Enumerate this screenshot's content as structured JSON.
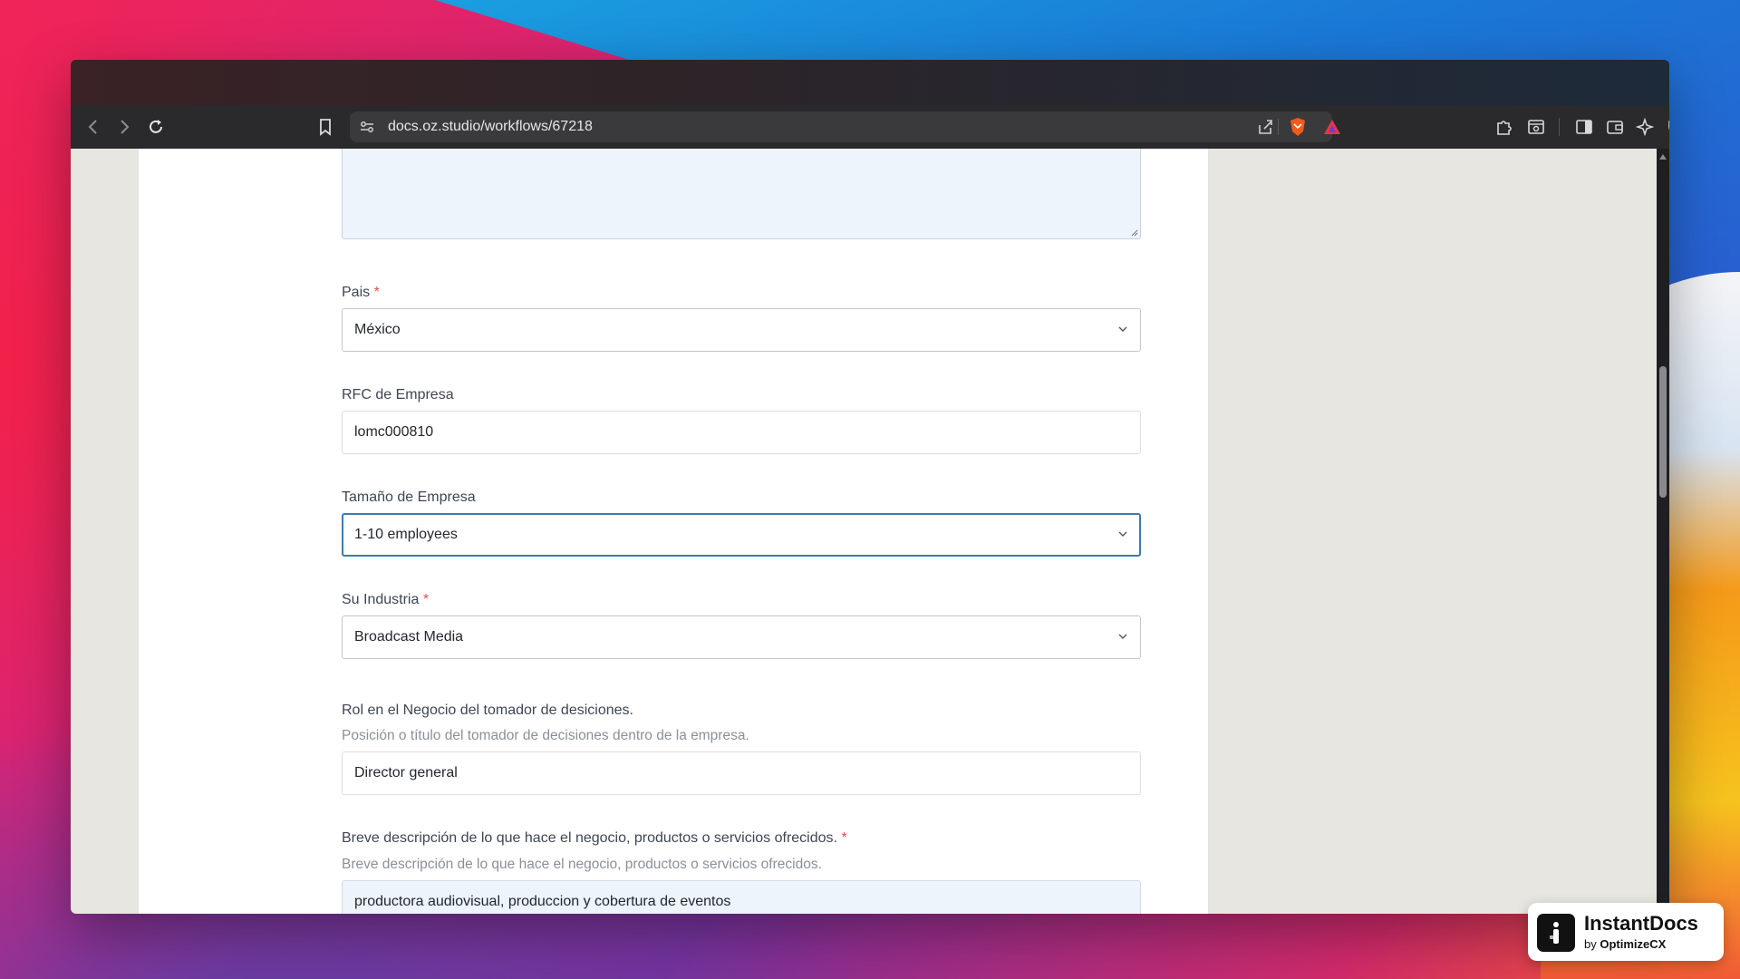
{
  "browser": {
    "url": "docs.oz.studio/workflows/67218"
  },
  "form": {
    "pais": {
      "label": "Pais",
      "required_mark": "*",
      "value": "México"
    },
    "rfc": {
      "label": "RFC de Empresa",
      "value": "lomc000810"
    },
    "tamano": {
      "label": "Tamaño de Empresa",
      "value": "1-10 employees"
    },
    "industria": {
      "label": "Su Industria",
      "required_mark": "*",
      "value": "Broadcast Media"
    },
    "rol": {
      "label": "Rol en el Negocio del tomador de desiciones.",
      "help": "Posición o título del tomador de decisiones dentro de la empresa.",
      "value": "Director general"
    },
    "descripcion": {
      "label": "Breve descripción de lo que hace el negocio, productos o servicios ofrecidos.",
      "required_mark": "*",
      "help": "Breve descripción de lo que hace el negocio, productos o servicios ofrecidos.",
      "value": "productora audiovisual, produccion y cobertura de eventos"
    }
  },
  "badge": {
    "title": "InstantDocs",
    "sub_prefix": "by",
    "sub_brand": "OptimizeCX"
  },
  "icons": {
    "back": "back-icon",
    "forward": "forward-icon",
    "reload": "reload-icon",
    "bookmark": "bookmark-icon",
    "site_settings": "site-settings-icon",
    "share": "share-icon",
    "brave_shield": "brave-shield-icon",
    "brave_rewards": "brave-rewards-icon",
    "extensions": "extensions-icon",
    "reader_mode": "reader-mode-icon",
    "sidebar": "sidebar-icon",
    "wallet": "wallet-icon",
    "leo_ai": "leo-ai-icon",
    "vpn": "vpn-icon",
    "menu": "menu-icon"
  },
  "colors": {
    "focus_border": "#3b7ab3",
    "required": "#e0504b",
    "autofill_bg": "#eef4fc"
  }
}
